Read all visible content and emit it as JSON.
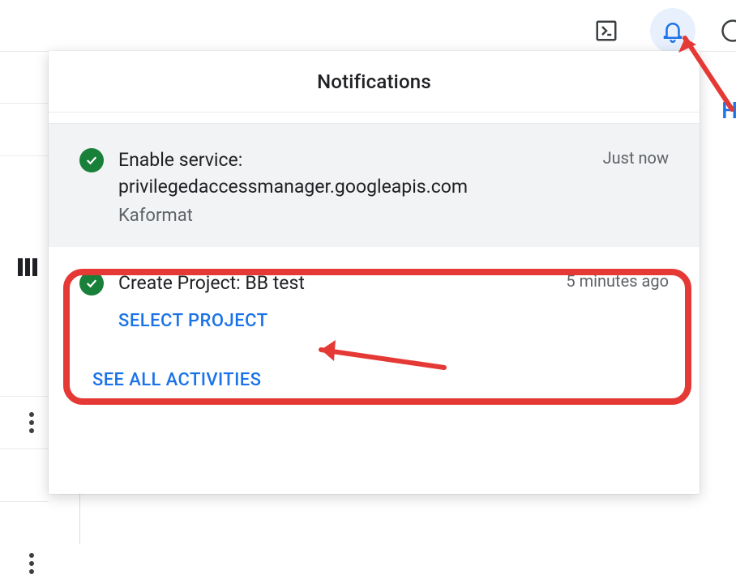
{
  "panel": {
    "title": "Notifications",
    "footer_link": "SEE ALL ACTIVITIES"
  },
  "notifications": [
    {
      "title": "Enable service: privilegedaccessmanager.googleapis.com",
      "project": "Kaformat",
      "time": "Just now",
      "action": ""
    },
    {
      "title": "Create Project: BB test",
      "project": "",
      "time": "5 minutes ago",
      "action": "SELECT PROJECT"
    }
  ],
  "fragments": {
    "partial_h": "H"
  }
}
